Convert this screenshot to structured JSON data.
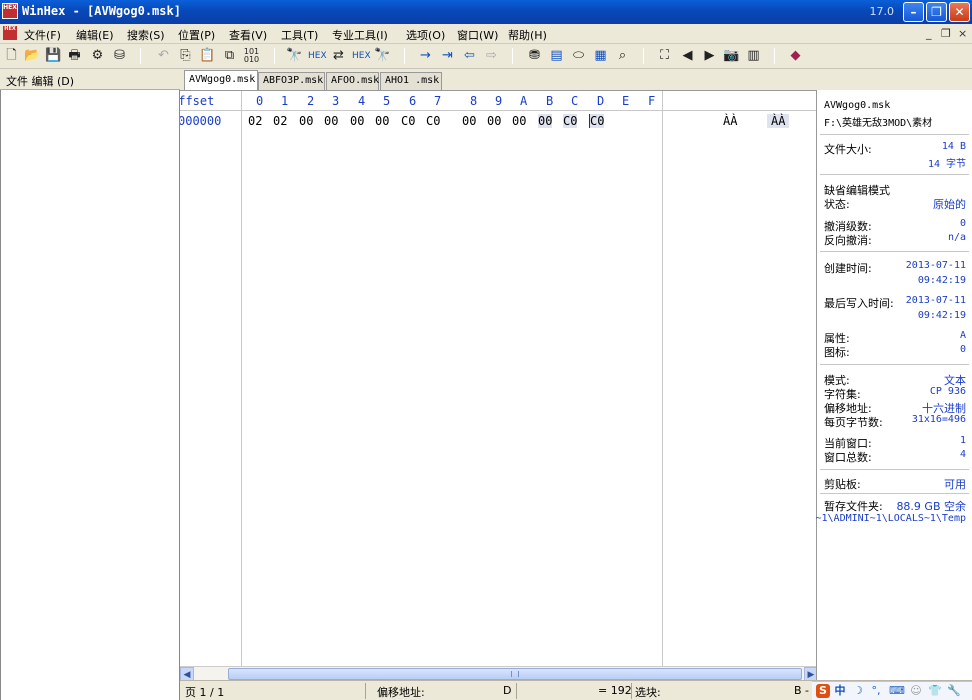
{
  "window": {
    "app_icon_text": "HEX",
    "title": "WinHex - [AVWgog0.msk]",
    "version": "17.0",
    "minimize_icon": "minimize-icon",
    "maximize_icon": "maximize-icon",
    "close_icon": "close-icon"
  },
  "menu": {
    "items": [
      "文件(F)",
      "编辑(E)",
      "搜索(S)",
      "位置(P)",
      "查看(V)",
      "工具(T)",
      "专业工具(I)",
      "选项(O)",
      "窗口(W)",
      "帮助(H)"
    ],
    "mdi_min": "_",
    "mdi_restore": "❐",
    "mdi_close": "×"
  },
  "toolbar": {
    "icons": [
      "new-file-icon",
      "open-icon",
      "save-icon",
      "print-icon",
      "properties-icon",
      "open-disk-icon",
      "undo-icon",
      "copy-icon",
      "paste-icon",
      "paste-special-icon",
      "convert-icon",
      "find-icon",
      "find-hex-icon",
      "replace-icon",
      "replace-hex-icon",
      "find-next-icon",
      "goto-icon",
      "goto-offset-icon",
      "back-icon",
      "forward-icon",
      "disk-icon",
      "ram-icon",
      "drive-icon",
      "calculator-icon",
      "search-icon",
      "crop-icon",
      "prev-icon",
      "next-icon",
      "camera-icon",
      "table-icon",
      "help-icon"
    ]
  },
  "left_panel": {
    "header": "文件 编辑 (D)"
  },
  "tabs": [
    {
      "label": "AVWgog0.msk",
      "active": true
    },
    {
      "label": "ABFO3P.msk",
      "active": false
    },
    {
      "label": "AFOO.msk",
      "active": false
    },
    {
      "label": "AHO1 .msk",
      "active": false
    }
  ],
  "hex": {
    "offset_header": "Offset",
    "columns": [
      "0",
      "1",
      "2",
      "3",
      "4",
      "5",
      "6",
      "7",
      "8",
      "9",
      "A",
      "B",
      "C",
      "D",
      "E",
      "F"
    ],
    "rows": [
      {
        "offset": "000000",
        "bytes": [
          "02",
          "02",
          "00",
          "00",
          "00",
          "00",
          "C0",
          "C0",
          "00",
          "00",
          "00",
          "00",
          "C0",
          "C0"
        ],
        "text1": "ÀÀ",
        "text2": "ÀÀ"
      }
    ]
  },
  "info": {
    "filename": "AVWgog0.msk",
    "path": "F:\\英雄无敌3MOD\\素材",
    "size_label": "文件大小:",
    "size_bytes": "14 B",
    "size_words": "14 字节",
    "edit_mode_label": "缺省编辑模式",
    "state_label": "状态:",
    "state_value": "原始的",
    "undo_label": "撤消级数:",
    "undo_value": "0",
    "reverse_label": "反向撤消:",
    "reverse_value": "n/a",
    "created_label": "创建时间:",
    "created_date": "2013-07-11",
    "created_time": "09:42:19",
    "written_label": "最后写入时间:",
    "written_date": "2013-07-11",
    "written_time": "09:42:19",
    "attr_label": "属性:",
    "attr_value": "A",
    "icon_label": "图标:",
    "icon_value": "0",
    "mode_label": "模式:",
    "mode_value": "文本",
    "charset_label": "字符集:",
    "charset_value": "CP 936",
    "offsets_label": "偏移地址:",
    "offsets_value": "十六进制",
    "bpp_label": "每页字节数:",
    "bpp_value": "31x16=496",
    "cur_win_label": "当前窗口:",
    "cur_win_value": "1",
    "total_win_label": "窗口总数:",
    "total_win_value": "4",
    "clipboard_label": "剪贴板:",
    "clipboard_value": "可用",
    "temp_label": "暂存文件夹:",
    "temp_value": "88.9 GB 空余",
    "temp_path": "~1\\ADMINI~1\\LOCALS~1\\Temp"
  },
  "status": {
    "page": "页 1 / 1",
    "offset_label": "偏移地址:",
    "offset_value": "D",
    "value": "= 192",
    "block_label": "选块:",
    "block_value": "B -"
  },
  "ime": {
    "logo": "S",
    "lang": "中",
    "items": [
      "moon-icon",
      "punct-icon",
      "keyboard-icon",
      "user-icon",
      "shirt-icon",
      "wrench-icon"
    ]
  }
}
